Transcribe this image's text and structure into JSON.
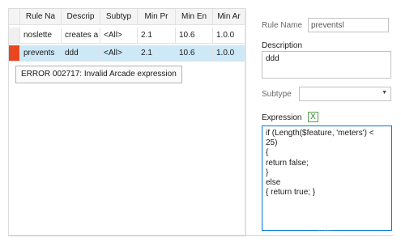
{
  "grid": {
    "columns": [
      "Rule Na",
      "Descrip",
      "Subtyp",
      "Min Pr",
      "Min En",
      "Min Ar"
    ],
    "rows": [
      {
        "cells": [
          "noslette",
          "creates a",
          "<All>",
          "2.1",
          "10.6",
          "1.0.0"
        ],
        "selected": false,
        "error": false
      },
      {
        "cells": [
          "prevents",
          "ddd",
          "<All>",
          "2.1",
          "10.6",
          "1.0.0"
        ],
        "selected": true,
        "error": true
      }
    ],
    "error_indicator_color": "#e8461f",
    "selected_row_color": "#cde8f7"
  },
  "tooltip": {
    "text": "ERROR 002717: Invalid Arcade expression"
  },
  "details": {
    "rule_name_label": "Rule Name",
    "rule_name_value": "preventsl",
    "description_label": "Description",
    "description_value": "ddd",
    "subtype_label": "Subtype",
    "subtype_value": "",
    "expression_label": "Expression",
    "expression_button_icon": "x-expression-icon",
    "expression_lines": [
      "if (Length($feature, 'meters') <",
      "25)",
      "{",
      "return false;",
      "}",
      "else",
      "{  return true; }"
    ],
    "expression_focus_color": "#0078d7"
  }
}
